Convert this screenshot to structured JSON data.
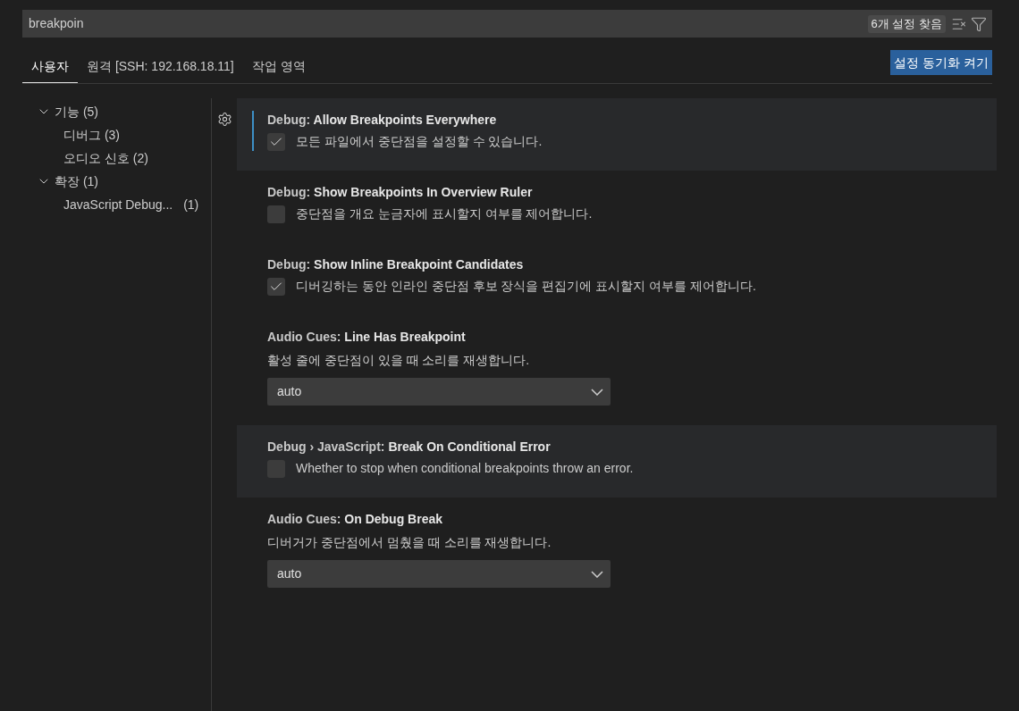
{
  "search": {
    "value": "breakpoin",
    "result_count": "6개 설정 찾음"
  },
  "tabs": [
    {
      "label": "사용자",
      "selected": true
    },
    {
      "label": "원격 [SSH: 192.168.18.11]",
      "selected": false
    },
    {
      "label": "작업 영역",
      "selected": false
    }
  ],
  "sync_button": "설정 동기화 켜기",
  "sidebar": {
    "items": [
      {
        "label": "기능 (5)",
        "expanded": true,
        "children": [
          {
            "label": "디버그 (3)"
          },
          {
            "label": "오디오 신호 (2)"
          }
        ]
      },
      {
        "label": "확장 (1)",
        "expanded": true,
        "children": [
          {
            "label": "JavaScript Debug...",
            "count": "(1)"
          }
        ]
      }
    ]
  },
  "settings": [
    {
      "kind": "checkbox",
      "category": "Debug:",
      "name": "Allow Breakpoints Everywhere",
      "description": "모든 파일에서 중단점을 설정할 수 있습니다.",
      "checked": true,
      "highlighted": true,
      "focused": true
    },
    {
      "kind": "checkbox",
      "category": "Debug:",
      "name": "Show Breakpoints In Overview Ruler",
      "description": "중단점을 개요 눈금자에 표시할지 여부를 제어합니다.",
      "checked": false,
      "highlighted": false,
      "focused": false
    },
    {
      "kind": "checkbox",
      "category": "Debug:",
      "name": "Show Inline Breakpoint Candidates",
      "description": "디버깅하는 동안 인라인 중단점 후보 장식을 편집기에 표시할지 여부를 제어합니다.",
      "checked": true,
      "highlighted": false,
      "focused": false
    },
    {
      "kind": "select",
      "category": "Audio Cues:",
      "name": "Line Has Breakpoint",
      "description": "활성 줄에 중단점이 있을 때 소리를 재생합니다.",
      "value": "auto",
      "highlighted": false,
      "focused": false
    },
    {
      "kind": "checkbox",
      "category": "Debug › JavaScript:",
      "name": "Break On Conditional Error",
      "description": "Whether to stop when conditional breakpoints throw an error.",
      "checked": false,
      "highlighted": true,
      "focused": false
    },
    {
      "kind": "select",
      "category": "Audio Cues:",
      "name": "On Debug Break",
      "description": "디버거가 중단점에서 멈췄을 때 소리를 재생합니다.",
      "value": "auto",
      "highlighted": false,
      "focused": false
    }
  ]
}
